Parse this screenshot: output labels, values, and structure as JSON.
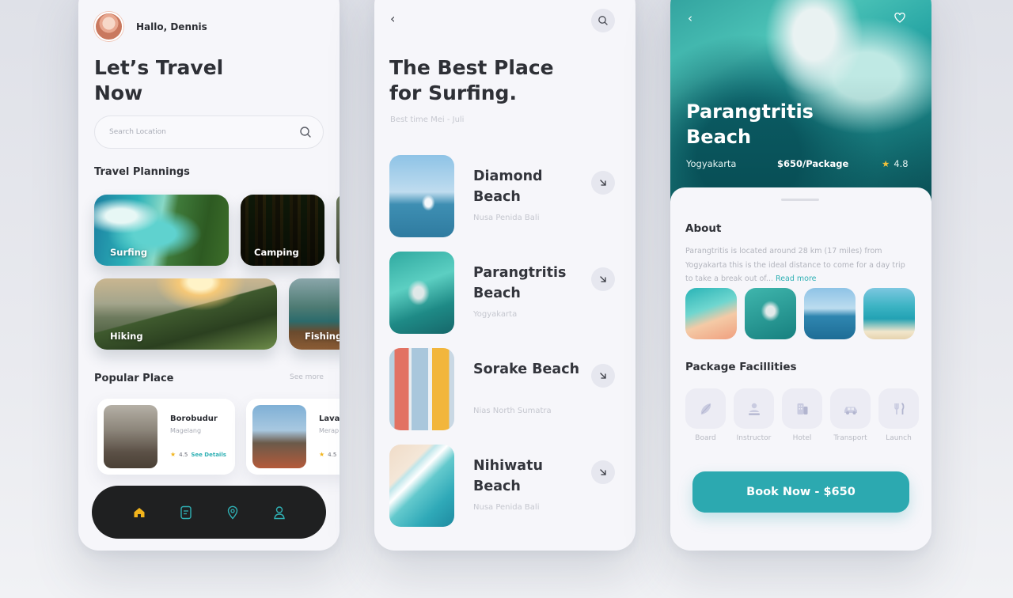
{
  "screen1": {
    "greeting": "Hallo, Dennis",
    "title": "Let’s Travel Now",
    "search_placeholder": "Search Location",
    "section_travel": "Travel Plannings",
    "categories": [
      {
        "label": "Surfing"
      },
      {
        "label": "Camping"
      },
      {
        "label": "Hiking"
      },
      {
        "label": "Fishing"
      }
    ],
    "section_popular": "Popular Place",
    "see_more": "See more",
    "popular": [
      {
        "name": "Borobudur",
        "location": "Magelang",
        "rating": "4.5",
        "details": "See Details"
      },
      {
        "name": "Lava",
        "location": "Merap",
        "rating": "4.5",
        "details": ""
      }
    ],
    "nav": [
      "home-icon",
      "document-icon",
      "location-pin-icon",
      "user-icon"
    ],
    "accent": "#f2b41c"
  },
  "screen2": {
    "title": "The Best Place for Surfing.",
    "subtitle": "Best time Mei - Juli",
    "beaches": [
      {
        "name": "Diamond Beach",
        "location": "Nusa Penida Bali"
      },
      {
        "name": "Parangtritis Beach",
        "location": "Yogyakarta"
      },
      {
        "name": "Sorake Beach",
        "location": "Nias North Sumatra"
      },
      {
        "name": "Nihiwatu Beach",
        "location": "Nusa Penida Bali"
      }
    ]
  },
  "screen3": {
    "title": "Parangtritis Beach",
    "location": "Yogyakarta",
    "price": "$650/Package",
    "rating": "4.8",
    "about_heading": "About",
    "about_text": "Parangtritis is located around 28 km (17 miles) from Yogyakarta this is the ideal distance to come for a day trip to take a break out of... ",
    "read_more": "Read more",
    "facilities_heading": "Package Facillities",
    "facilities": [
      {
        "label": "Board",
        "icon": "surfboard-icon"
      },
      {
        "label": "Instructor",
        "icon": "instructor-icon"
      },
      {
        "label": "Hotel",
        "icon": "hotel-icon"
      },
      {
        "label": "Transport",
        "icon": "car-icon"
      },
      {
        "label": "Launch",
        "icon": "cutlery-icon"
      }
    ],
    "book_label": "Book Now - $650",
    "accent": "#2ca9b0"
  }
}
